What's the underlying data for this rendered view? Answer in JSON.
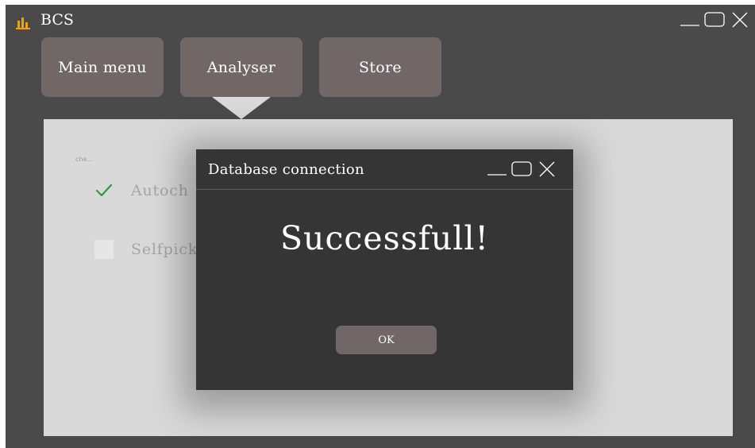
{
  "app": {
    "title": "BCS",
    "logo_icon": "bar-chart-icon",
    "accent_color": "#e8a317"
  },
  "window_controls": [
    "minimize-icon",
    "maximize-icon",
    "close-icon"
  ],
  "tabs": [
    {
      "label": "Main menu"
    },
    {
      "label": "Analyser",
      "selected": true
    },
    {
      "label": "Store"
    }
  ],
  "content": {
    "caption": "che...",
    "options": [
      {
        "label": "Autoch",
        "checked": true
      },
      {
        "label": "Selfpick",
        "checked": false
      }
    ]
  },
  "dialog": {
    "title": "Database connection",
    "message": "Successfull!",
    "ok_label": "OK"
  },
  "colors": {
    "window_bg": "#4a4a4a",
    "tab_bg": "#716767",
    "content_bg": "#d9d9d9",
    "dialog_bg": "#353535",
    "check_color": "#2e9b3a"
  }
}
